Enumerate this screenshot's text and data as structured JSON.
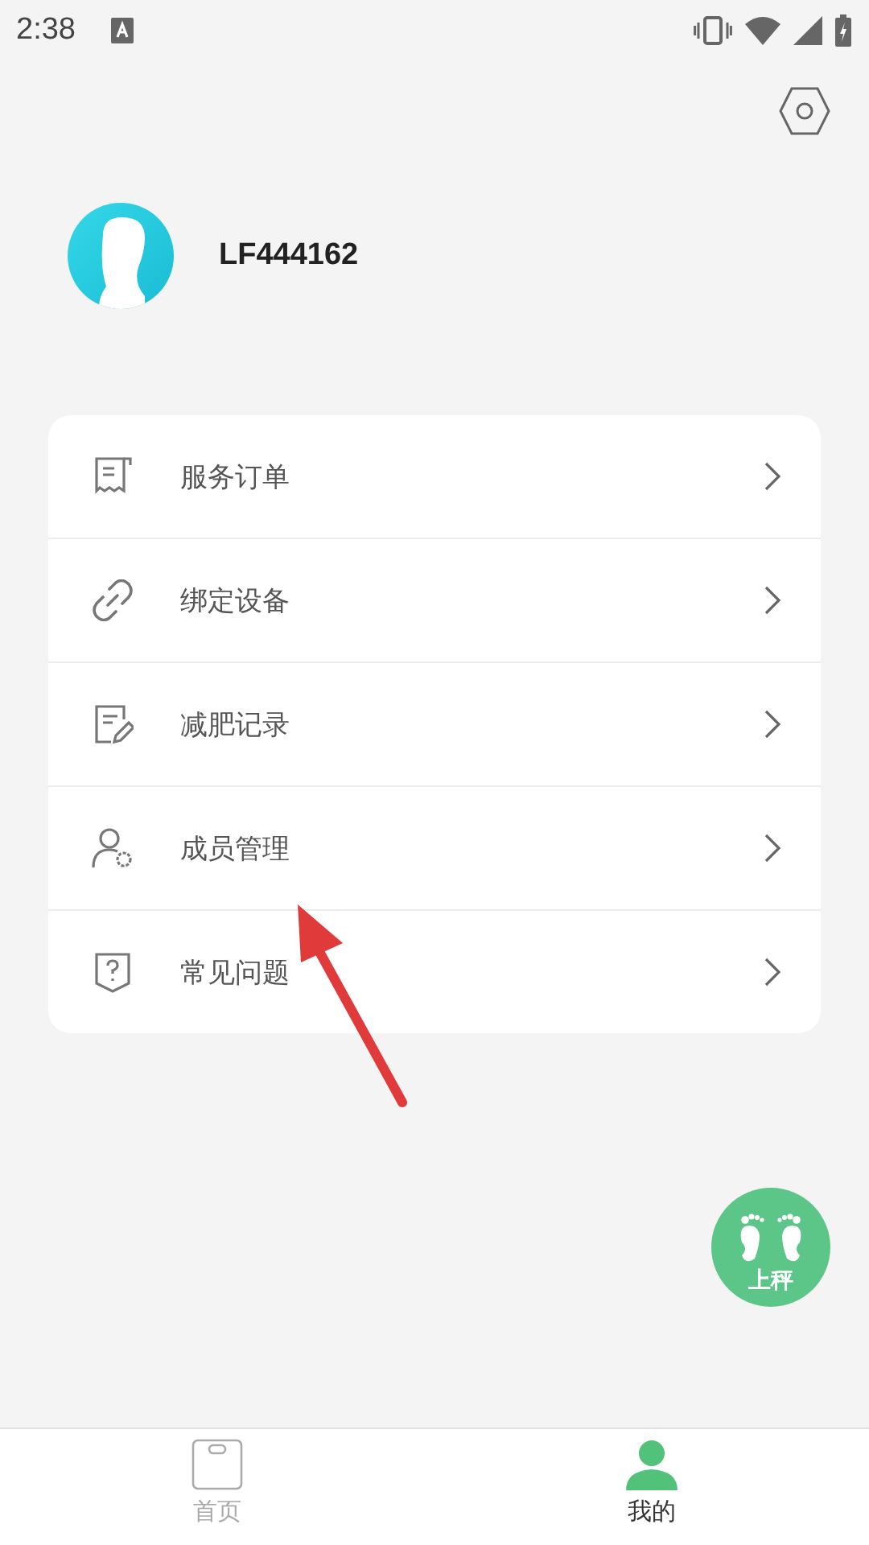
{
  "status_bar": {
    "time": "2:38"
  },
  "profile": {
    "name": "LF444162"
  },
  "menu": [
    {
      "kind": "receipt",
      "label": "服务订单"
    },
    {
      "kind": "link",
      "label": "绑定设备"
    },
    {
      "kind": "note",
      "label": "减肥记录"
    },
    {
      "kind": "member",
      "label": "成员管理"
    },
    {
      "kind": "help",
      "label": "常见问题"
    }
  ],
  "weigh_button": {
    "label": "上秤"
  },
  "tabs": [
    {
      "kind": "scale",
      "label": "首页",
      "selected": false
    },
    {
      "kind": "person",
      "label": "我的",
      "selected": true
    }
  ]
}
